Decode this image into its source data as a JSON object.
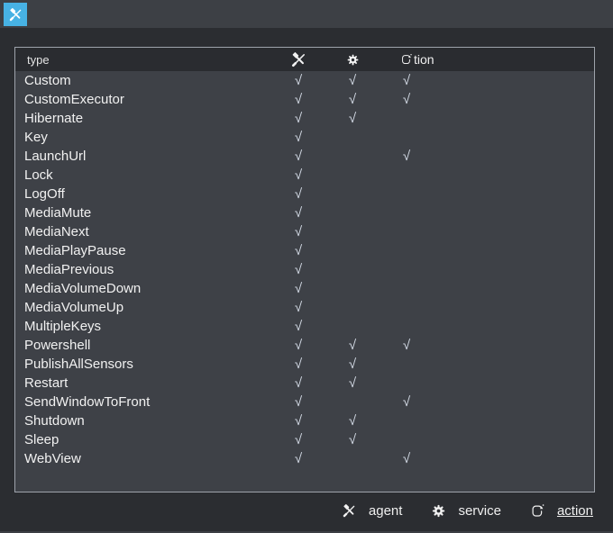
{
  "window": {
    "app_icon": "tools-icon",
    "colors": {
      "outer_bg": "#2b2d31",
      "titlebar_bg": "#3d4045",
      "grid_body_bg": "#3e4147",
      "grid_header_bg": "#2a2c30",
      "grid_border": "#9ea3ab",
      "accent_blue": "#47b2e4",
      "text": "#f1f1f1",
      "check": "#d6dde8"
    }
  },
  "table": {
    "check_glyph": "√",
    "header": {
      "type_label": "type",
      "columns": [
        {
          "id": "agent",
          "icon": "tools-icon",
          "label": ""
        },
        {
          "id": "service",
          "icon": "gear-icon",
          "label": ""
        },
        {
          "id": "action",
          "icon": "action-icon",
          "label": "tion"
        }
      ]
    },
    "rows": [
      {
        "type": "Custom",
        "agent": true,
        "service": true,
        "action": true
      },
      {
        "type": "CustomExecutor",
        "agent": true,
        "service": true,
        "action": true
      },
      {
        "type": "Hibernate",
        "agent": true,
        "service": true,
        "action": false
      },
      {
        "type": "Key",
        "agent": true,
        "service": false,
        "action": false
      },
      {
        "type": "LaunchUrl",
        "agent": true,
        "service": false,
        "action": true
      },
      {
        "type": "Lock",
        "agent": true,
        "service": false,
        "action": false
      },
      {
        "type": "LogOff",
        "agent": true,
        "service": false,
        "action": false
      },
      {
        "type": "MediaMute",
        "agent": true,
        "service": false,
        "action": false
      },
      {
        "type": "MediaNext",
        "agent": true,
        "service": false,
        "action": false
      },
      {
        "type": "MediaPlayPause",
        "agent": true,
        "service": false,
        "action": false
      },
      {
        "type": "MediaPrevious",
        "agent": true,
        "service": false,
        "action": false
      },
      {
        "type": "MediaVolumeDown",
        "agent": true,
        "service": false,
        "action": false
      },
      {
        "type": "MediaVolumeUp",
        "agent": true,
        "service": false,
        "action": false
      },
      {
        "type": "MultipleKeys",
        "agent": true,
        "service": false,
        "action": false
      },
      {
        "type": "Powershell",
        "agent": true,
        "service": true,
        "action": true
      },
      {
        "type": "PublishAllSensors",
        "agent": true,
        "service": true,
        "action": false
      },
      {
        "type": "Restart",
        "agent": true,
        "service": true,
        "action": false
      },
      {
        "type": "SendWindowToFront",
        "agent": true,
        "service": false,
        "action": true
      },
      {
        "type": "Shutdown",
        "agent": true,
        "service": true,
        "action": false
      },
      {
        "type": "Sleep",
        "agent": true,
        "service": true,
        "action": false
      },
      {
        "type": "WebView",
        "agent": true,
        "service": false,
        "action": true
      }
    ]
  },
  "legend": {
    "items": [
      {
        "icon": "tools-icon",
        "label": "agent",
        "underline": false
      },
      {
        "icon": "gear-icon",
        "label": "service",
        "underline": false
      },
      {
        "icon": "action-icon",
        "label": "action",
        "underline": true
      }
    ]
  }
}
